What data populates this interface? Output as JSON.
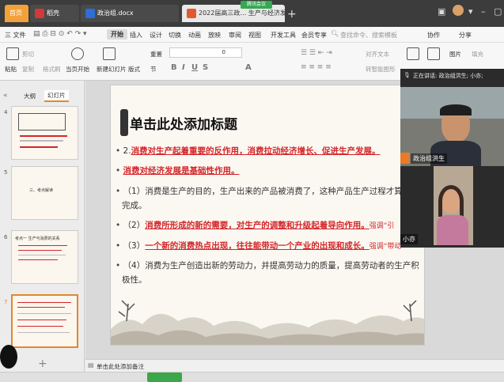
{
  "tabs": [
    {
      "label": "首页"
    },
    {
      "label": "稻壳"
    },
    {
      "label": "政治组.docx"
    },
    {
      "label": "2022届高三政… 生产与经济发展"
    }
  ],
  "meeting_badge": "腾讯会议",
  "menu": [
    "三 文件",
    "开始",
    "插入",
    "设计",
    "切换",
    "动画",
    "放映",
    "审阅",
    "视图",
    "开发工具",
    "会员专享",
    "查找命令、搜索模板",
    "协作",
    "分享"
  ],
  "ribbon": {
    "paste": "粘贴",
    "cut": "剪切",
    "copy": "复制",
    "format_painter": "格式刷",
    "play_from_current": "当页开始",
    "new_slide": "新建幻灯片",
    "layout": "版式",
    "section": "节",
    "reset": "重置",
    "font_size": "0",
    "text_direction": "对齐文本",
    "picture": "图片",
    "fill": "填充",
    "smart_art": "转智能图形"
  },
  "left_panel": {
    "tab_outline": "大纲",
    "tab_slides": "幻灯片",
    "slides": [
      {
        "num": "4"
      },
      {
        "num": "5",
        "text": "三、考点解读"
      },
      {
        "num": "6",
        "text": "考点一 生产与消费的关系"
      },
      {
        "num": "7"
      }
    ]
  },
  "slide": {
    "title": "单击此处添加标题",
    "p1_num": "2.",
    "p1": "消费对生产起着重要的反作用，消费拉动经济增长、促进生产发展。",
    "p2": "消费对经济发展是基础性作用。",
    "p3_num": "（1）",
    "p3": "消费是生产的目的，生产出来的产品被消费了，这种产品生产过程才算",
    "p3b": "完成。",
    "p4_num": "（2）",
    "p4": "消费所形成的新的需要，对生产的调整和升级起着导向作用。",
    "p4_tail": "强调“引",
    "p5_num": "（3）",
    "p5": "一个新的消费热点出现，往往能带动一个产业的出现和成长。",
    "p5_tail": "强调“带动",
    "p6_num": "（4）",
    "p6": "消费为生产创造出新的劳动力，并提高劳动力的质量，提高劳动者的生产积",
    "p6b": "极性。"
  },
  "notes_placeholder": "单击此处添加备注",
  "video": {
    "speaking": "正在讲话: 政治组洪生; 小亦;",
    "participant1": "政治组洪生",
    "participant2": "小亦"
  },
  "colors": {
    "accent": "#e0892c",
    "red_text": "#d4262a"
  }
}
